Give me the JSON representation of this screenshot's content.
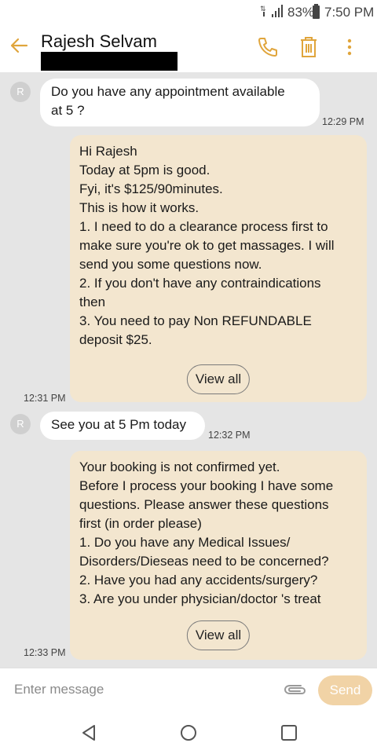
{
  "status_bar": {
    "battery": "83%",
    "time": "7:50 PM",
    "icons": [
      "wifi-icon",
      "signal-icon",
      "battery-icon"
    ]
  },
  "header": {
    "contact_name": "Rajesh Selvam",
    "icons": [
      "back-arrow-icon",
      "phone-icon",
      "trash-icon",
      "more-vert-icon"
    ]
  },
  "colors": {
    "accent": "#e0a53c",
    "chat_bg": "#e5e5e5",
    "outgoing_bubble": "#f3e6cf",
    "send_button": "#f1d3a6"
  },
  "messages": [
    {
      "direction": "incoming",
      "avatar": "R",
      "lines": [
        "Do you have any appointment available",
        "at 5 ?"
      ],
      "time": "12:29 PM"
    },
    {
      "direction": "outgoing",
      "lines": [
        "Hi Rajesh",
        "Today at 5pm is  good.",
        "Fyi, it's $125/90minutes.",
        "This is how it works.",
        "1. I need to do a clearance process first to",
        "make sure you're ok to get massages. I will",
        "send you some questions now.",
        "2. If you don't have any contraindications",
        "then",
        "3. You need to pay Non REFUNDABLE",
        "deposit $25."
      ],
      "view_all": "View all",
      "time": "12:31 PM"
    },
    {
      "direction": "incoming",
      "avatar": "R",
      "lines": [
        "See you at 5 Pm today"
      ],
      "time": "12:32 PM"
    },
    {
      "direction": "outgoing",
      "lines": [
        "Your booking is not confirmed yet.",
        "Before I process your booking I have some",
        "questions. Please answer these questions",
        "first (in order please)",
        "1. Do you have any Medical Issues/",
        "Disorders/Dieseas need to be concerned?",
        "2. Have you had any accidents/surgery?",
        "3. Are you under physician/doctor 's treat"
      ],
      "view_all": "View all",
      "time": "12:33 PM"
    }
  ],
  "composer": {
    "placeholder": "Enter message",
    "send_label": "Send",
    "icons": [
      "attach-icon"
    ]
  },
  "nav_bar": {
    "icons": [
      "back-triangle-icon",
      "home-circle-icon",
      "recents-square-icon"
    ]
  }
}
